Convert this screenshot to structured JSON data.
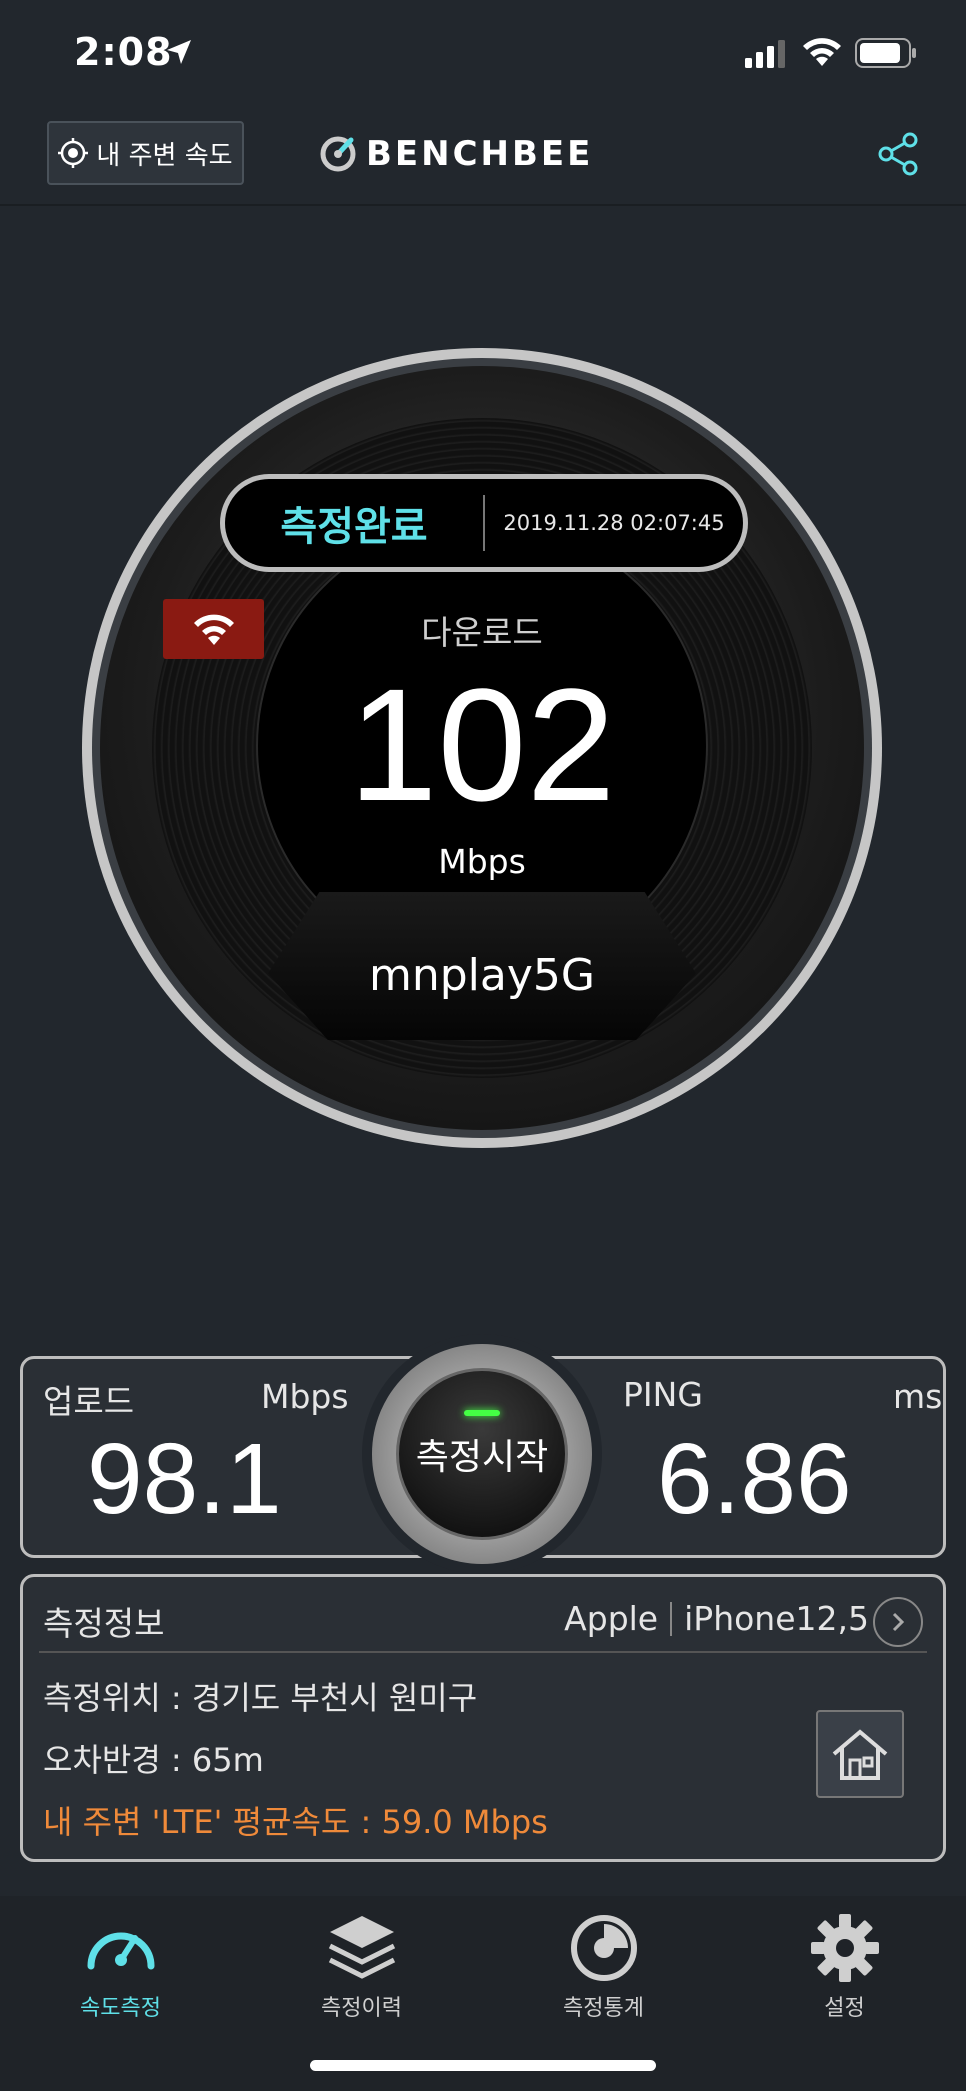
{
  "status_bar": {
    "time": "2:08",
    "icons": [
      "location-arrow-icon",
      "cellular-signal-icon",
      "wifi-icon",
      "battery-icon"
    ]
  },
  "header": {
    "nearby_button_label": "내 주변 속도",
    "logo_text": "BENCHBEE",
    "share_icon": "share-icon"
  },
  "gauge": {
    "status": "측정완료",
    "datetime": "2019.11.28 02:07:45",
    "connection_icon": "wifi-icon",
    "download_label": "다운로드",
    "download_value": "102",
    "download_unit": "Mbps",
    "network_name": "mnplay5G"
  },
  "results": {
    "upload_label": "업로드",
    "upload_unit": "Mbps",
    "upload_value": "98.1",
    "ping_label": "PING",
    "ping_unit": "ms",
    "ping_value": "6.86",
    "start_button_label": "측정시작"
  },
  "info": {
    "title": "측정정보",
    "device_brand": "Apple",
    "device_model": "iPhone12,5",
    "location": "측정위치 : 경기도 부천시 원미구",
    "error_radius": "오차반경 : 65m",
    "nearby_average": "내 주변 'LTE' 평균속도 : 59.0 Mbps"
  },
  "tabs": [
    {
      "label": "속도측정",
      "icon": "speedometer-icon",
      "active": true
    },
    {
      "label": "측정이력",
      "icon": "layers-icon",
      "active": false
    },
    {
      "label": "측정통계",
      "icon": "statistics-icon",
      "active": false
    },
    {
      "label": "설정",
      "icon": "gear-icon",
      "active": false
    }
  ],
  "colors": {
    "accent": "#5fe0e8",
    "warning_text": "#ef8a3a",
    "wifi_badge": "#8a1a12",
    "background": "#22272d"
  }
}
